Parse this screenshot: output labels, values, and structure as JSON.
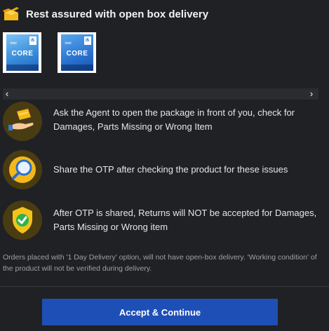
{
  "header": {
    "title": "Rest assured with open box delivery",
    "icon": "open-box-icon",
    "icon_color": "#f5b81a"
  },
  "thumbnails": [
    {
      "brand": "intel",
      "label": "CORE",
      "badge": "i5"
    },
    {
      "brand": "intel",
      "label": "CORE",
      "badge": "i5"
    }
  ],
  "carousel": {
    "prev_icon": "chevron-left-icon",
    "next_icon": "chevron-right-icon",
    "prev_label": "‹",
    "next_label": "›"
  },
  "steps": [
    {
      "icon": "hand-package-icon",
      "text": "Ask the Agent to open the package in front of you, check for Damages, Parts Missing or Wrong Item"
    },
    {
      "icon": "magnifier-icon",
      "text": "Share the OTP after checking the product for these issues"
    },
    {
      "icon": "shield-check-icon",
      "text": "After OTP is shared, Returns will NOT be accepted for Damages, Parts Missing or Wrong item"
    }
  ],
  "note": "Orders placed with '1 Day Delivery' option, will not have open-box delivery. 'Working condition' of the product will not be verified during delivery.",
  "cta": {
    "label": "Accept & Continue",
    "color": "#1e4fb7"
  }
}
